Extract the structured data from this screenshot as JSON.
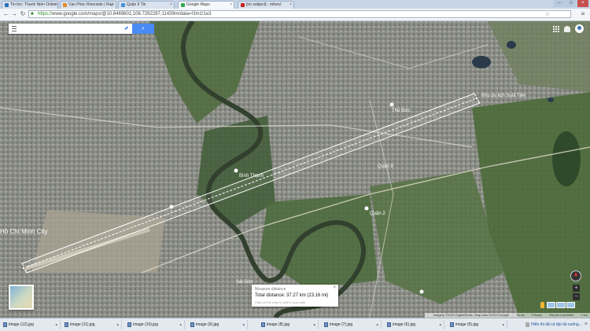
{
  "tabs": [
    {
      "label": "Tin tức: Thanh Niên Online",
      "color": "#2d6fb8"
    },
    {
      "label": "Vạn Phúc Riverside | Rap",
      "color": "#e58a2a"
    },
    {
      "label": "Quận 9 Tin",
      "color": "#4a90d9"
    },
    {
      "label": "Google Maps",
      "color": "#34a853",
      "active": true
    },
    {
      "label": "[no subject] - mfsecl",
      "color": "#c5221f"
    }
  ],
  "window_controls": {
    "minimize": "–",
    "maximize": "□",
    "close": "×"
  },
  "address": {
    "scheme": "https://",
    "url": "www.google.com/maps/@10.8469601,106.7292287,11439m/data=!3m1!1e3"
  },
  "search": {
    "placeholder": "",
    "button_icon": "search-icon"
  },
  "map": {
    "places": [
      {
        "name": "Thủ Đức"
      },
      {
        "name": "Quận 9"
      },
      {
        "name": "Hồ Chí Minh City"
      },
      {
        "name": "Bình Thạnh"
      },
      {
        "name": "Quận 2"
      },
      {
        "name": "Khu du lịch Suối Tiên"
      },
      {
        "name": "Sài Gòn"
      }
    ]
  },
  "measure": {
    "title": "Measure distance",
    "distance": "Total distance: 37.27 km (23.16 mi)",
    "hint": "Click on the map to add to your path",
    "close": "×"
  },
  "attribution": {
    "imagery": "Imagery ©2015 DigitalGlobe, Map data ©2015 Google",
    "terms": "Terms",
    "privacy": "Privacy",
    "report": "Report a problem",
    "scale": "1 km"
  },
  "zoom": {
    "plus": "+",
    "minus": "−"
  },
  "downloads": [
    {
      "name": "image (12).jpg"
    },
    {
      "name": "image (11).jpg"
    },
    {
      "name": "image (10).jpg"
    },
    {
      "name": "image (9).jpg"
    },
    {
      "name": "image (8).jpg"
    },
    {
      "name": "image (7).jpg"
    },
    {
      "name": "image (6).jpg"
    },
    {
      "name": "image (5).jpg"
    }
  ],
  "download_bar": {
    "show_all": "Hiển thị tất cả tệp tải xuống...",
    "close": "×"
  }
}
